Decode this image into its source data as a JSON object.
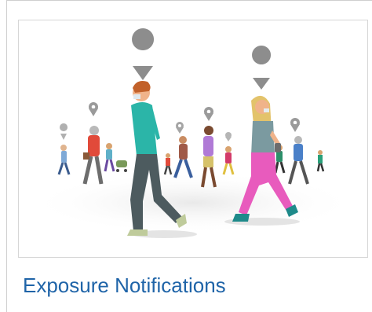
{
  "card": {
    "title": "Exposure Notifications"
  },
  "illustration": {
    "icon": "people-walking-with-location-pins",
    "colors": {
      "pin": "#8d8d8d",
      "teal_shirt": "#2bb5a8",
      "pink_pants": "#e85bbd",
      "title_link": "#1f64a8"
    }
  }
}
